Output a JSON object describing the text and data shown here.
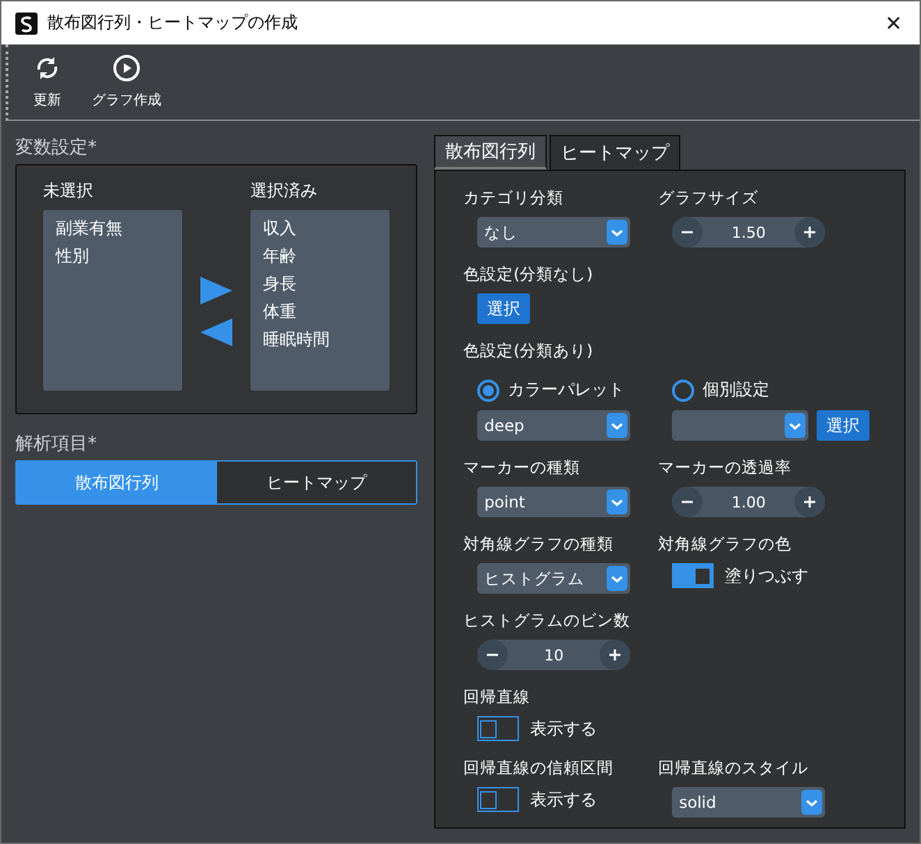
{
  "window": {
    "title": "散布図行列・ヒートマップの作成",
    "close": "✕"
  },
  "toolbar": [
    {
      "kind": "refresh",
      "label": "更新"
    },
    {
      "kind": "play",
      "label": "グラフ作成"
    }
  ],
  "variables": {
    "title": "変数設定*",
    "unselected": {
      "title": "未選択",
      "items": [
        "副業有無",
        "性別"
      ]
    },
    "selected": {
      "title": "選択済み",
      "items": [
        "収入",
        "年齢",
        "身長",
        "体重",
        "睡眠時間"
      ]
    }
  },
  "analysis": {
    "title": "解析項目*",
    "options": [
      {
        "label": "散布図行列",
        "selected": true
      },
      {
        "label": "ヒートマップ",
        "selected": false
      }
    ]
  },
  "tabs": [
    {
      "label": "散布図行列",
      "selected": true
    },
    {
      "label": "ヒートマップ",
      "selected": false
    }
  ],
  "rows": [
    {
      "cells": [
        {
          "label": "カテゴリ分類",
          "controls": [
            {
              "kind": "select",
              "value": "なし"
            }
          ]
        },
        {
          "label": "グラフサイズ",
          "controls": [
            {
              "kind": "spinner",
              "value": "1.50"
            }
          ]
        }
      ]
    },
    {
      "cells": [
        {
          "label": "色設定(分類なし)",
          "controls": [
            {
              "kind": "button",
              "label": "選択"
            }
          ]
        }
      ]
    },
    {
      "cells": [
        {
          "label": "色設定(分類あり)"
        }
      ]
    },
    {
      "cells": [
        {
          "controls": [
            {
              "kind": "radio",
              "label": "カラーパレット",
              "selected": true
            },
            {
              "kind": "select",
              "value": "deep"
            }
          ]
        },
        {
          "controls": [
            {
              "kind": "radio",
              "label": "個別設定",
              "selected": false
            },
            {
              "kind": "select",
              "button": "選択"
            }
          ]
        }
      ]
    },
    {
      "cells": [
        {
          "label": "マーカーの種類",
          "controls": [
            {
              "kind": "select",
              "value": "point"
            }
          ]
        },
        {
          "label": "マーカーの透過率",
          "controls": [
            {
              "kind": "spinner",
              "value": "1.00"
            }
          ]
        }
      ]
    },
    {
      "cells": [
        {
          "label": "対角線グラフの種類",
          "controls": [
            {
              "kind": "select",
              "value": "ヒストグラム"
            }
          ]
        },
        {
          "label": "対角線グラフの色",
          "controls": [
            {
              "kind": "toggle",
              "label": "塗りつぶす",
              "on": true
            }
          ]
        }
      ]
    },
    {
      "cells": [
        {
          "label": "ヒストグラムのビン数",
          "controls": [
            {
              "kind": "spinner",
              "value": "10"
            }
          ]
        }
      ]
    },
    {
      "cells": [
        {
          "label": "回帰直線",
          "controls": [
            {
              "kind": "toggle",
              "label": "表示する",
              "on": false
            }
          ]
        }
      ]
    },
    {
      "cells": [
        {
          "label": "回帰直線の信頼区間",
          "controls": [
            {
              "kind": "toggle",
              "label": "表示する",
              "on": false
            }
          ]
        },
        {
          "label": "回帰直線のスタイル",
          "controls": [
            {
              "kind": "select",
              "value": "solid"
            }
          ]
        }
      ]
    }
  ]
}
